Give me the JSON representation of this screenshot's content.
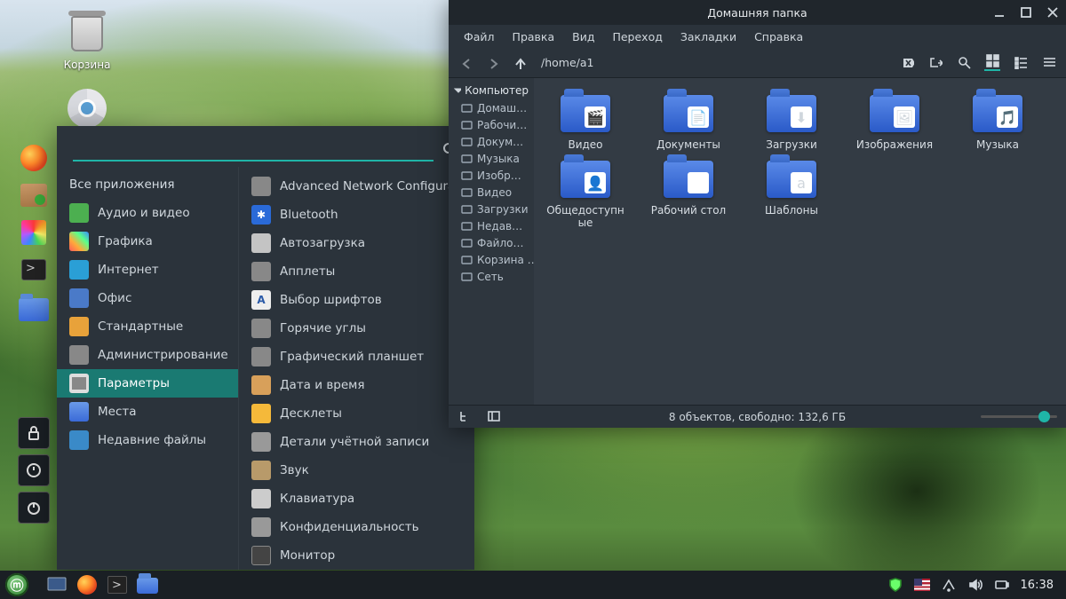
{
  "desktop": {
    "trash_label": "Корзина"
  },
  "app_menu": {
    "search_placeholder": "",
    "header": "Все приложения",
    "categories": [
      {
        "id": "audio-video",
        "label": "Аудио и видео",
        "icon": "mi-av"
      },
      {
        "id": "graphics",
        "label": "Графика",
        "icon": "mi-gr"
      },
      {
        "id": "internet",
        "label": "Интернет",
        "icon": "mi-net"
      },
      {
        "id": "office",
        "label": "Офис",
        "icon": "mi-off"
      },
      {
        "id": "accessories",
        "label": "Стандартные",
        "icon": "mi-std"
      },
      {
        "id": "administration",
        "label": "Администрирование",
        "icon": "mi-adm"
      },
      {
        "id": "preferences",
        "label": "Параметры",
        "icon": "mi-par",
        "selected": true
      },
      {
        "id": "places",
        "label": "Места",
        "icon": "mi-pla"
      },
      {
        "id": "recent",
        "label": "Недавние файлы",
        "icon": "mi-rec"
      }
    ],
    "apps": [
      {
        "id": "net-config",
        "label": "Advanced Network Configuration",
        "icon": "mi-cfg"
      },
      {
        "id": "bluetooth",
        "label": "Bluetooth",
        "icon": "mi-bt"
      },
      {
        "id": "autostart",
        "label": "Автозагрузка",
        "icon": "mi-auto"
      },
      {
        "id": "applets",
        "label": "Апплеты",
        "icon": "mi-app"
      },
      {
        "id": "fonts",
        "label": "Выбор шрифтов",
        "icon": "mi-font"
      },
      {
        "id": "hotcorners",
        "label": "Горячие углы",
        "icon": "mi-hot"
      },
      {
        "id": "tablet",
        "label": "Графический планшет",
        "icon": "mi-gtab"
      },
      {
        "id": "datetime",
        "label": "Дата и время",
        "icon": "mi-date"
      },
      {
        "id": "desklets",
        "label": "Десклеты",
        "icon": "mi-desk"
      },
      {
        "id": "accounts",
        "label": "Детали учётной записи",
        "icon": "mi-acc"
      },
      {
        "id": "sound",
        "label": "Звук",
        "icon": "mi-sound"
      },
      {
        "id": "keyboard",
        "label": "Клавиатура",
        "icon": "mi-kb"
      },
      {
        "id": "privacy",
        "label": "Конфиденциальность",
        "icon": "mi-priv"
      },
      {
        "id": "monitor",
        "label": "Монитор",
        "icon": "mi-mon"
      }
    ]
  },
  "fm": {
    "title": "Домашняя папка",
    "menus": [
      "Файл",
      "Правка",
      "Вид",
      "Переход",
      "Закладки",
      "Справка"
    ],
    "path": "/home/a1",
    "sidebar": {
      "header": "Компьютер",
      "items": [
        {
          "id": "home",
          "label": "Домаш…"
        },
        {
          "id": "desktop",
          "label": "Рабочи…"
        },
        {
          "id": "documents",
          "label": "Докум…"
        },
        {
          "id": "music",
          "label": "Музыка"
        },
        {
          "id": "pictures",
          "label": "Изобр…"
        },
        {
          "id": "video",
          "label": "Видео"
        },
        {
          "id": "downloads",
          "label": "Загрузки"
        },
        {
          "id": "recent",
          "label": "Недав…"
        },
        {
          "id": "filesystem",
          "label": "Файло…"
        },
        {
          "id": "trash",
          "label": "Корзина …"
        },
        {
          "id": "network",
          "label": "Сеть"
        }
      ]
    },
    "files": [
      {
        "id": "video",
        "label": "Видео",
        "emblem": "🎬"
      },
      {
        "id": "documents",
        "label": "Документы",
        "emblem": "📄"
      },
      {
        "id": "downloads",
        "label": "Загрузки",
        "emblem": "⬇"
      },
      {
        "id": "pictures",
        "label": "Изображения",
        "emblem": "🖼"
      },
      {
        "id": "music",
        "label": "Музыка",
        "emblem": "🎵"
      },
      {
        "id": "public",
        "label": "Общедоступные",
        "emblem": "👤"
      },
      {
        "id": "desktop",
        "label": "Рабочий стол",
        "emblem": ""
      },
      {
        "id": "templates",
        "label": "Шаблоны",
        "emblem": "a"
      }
    ],
    "status": "8 объектов, свободно: 132,6 ГБ"
  },
  "taskbar": {
    "clock": "16:38"
  }
}
